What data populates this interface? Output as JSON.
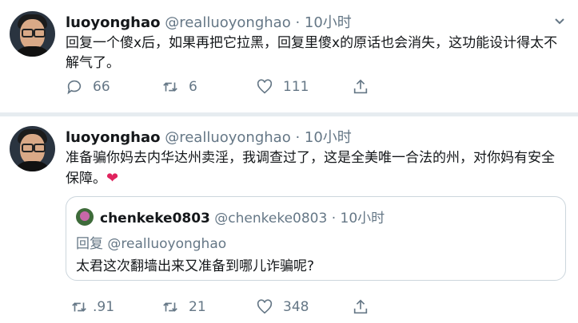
{
  "tweets": [
    {
      "name": "luoyonghao",
      "handle": "@realluoyonghao",
      "dot": "·",
      "time": "10小时",
      "text": "回复一个傻x后，如果再把它拉黑，回复里傻x的原话也会消失，这功能设计得太不解气了。",
      "actions": {
        "replies": "66",
        "retweets": "6",
        "likes": "111"
      }
    },
    {
      "name": "luoyonghao",
      "handle": "@realluoyonghao",
      "dot": "·",
      "time": "10小时",
      "text": "准备骗你妈去内华达州卖淫，我调查过了，这是全美唯一合法的州，对你妈有安全保障。",
      "emoji": "heart-emoji",
      "quote": {
        "name": "chenkeke0803",
        "handle": "@chenkeke0803",
        "dot": "·",
        "time": "10小时",
        "reply_to": "回复 @realluoyonghao",
        "text": "太君这次翻墙出来又准备到哪儿诈骗呢?"
      },
      "actions": {
        "retweets": ".91",
        "retweets2": "21",
        "likes": "348"
      }
    }
  ],
  "colors": {
    "secondary": "#657786",
    "heart": "#e0245e",
    "border": "#e6ecf0"
  },
  "icons": [
    "reply-icon",
    "retweet-icon",
    "like-icon",
    "share-icon",
    "chevron-down-icon"
  ]
}
